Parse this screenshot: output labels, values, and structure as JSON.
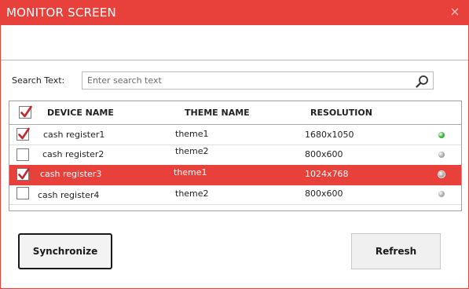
{
  "window": {
    "title": "MONITOR SCREEN",
    "close_glyph": "×"
  },
  "search": {
    "label": "Search Text:",
    "placeholder": "Enter search text",
    "value": ""
  },
  "table": {
    "headers": {
      "device": "DEVICE NAME",
      "theme": "THEME NAME",
      "resolution": "RESOLUTION"
    },
    "select_all_checked": true,
    "rows": [
      {
        "device": "cash register1",
        "theme": "theme1",
        "resolution": "1680x1050",
        "checked": true,
        "selected": false,
        "status": "online"
      },
      {
        "device": "cash register2",
        "theme": "theme2",
        "resolution": "800x600",
        "checked": false,
        "selected": false,
        "status": "offline"
      },
      {
        "device": "cash register3",
        "theme": "theme1",
        "resolution": "1024x768",
        "checked": true,
        "selected": true,
        "status": "offline"
      },
      {
        "device": "cash register4",
        "theme": "theme2",
        "resolution": "800x600",
        "checked": false,
        "selected": false,
        "status": "offline"
      }
    ]
  },
  "buttons": {
    "synchronize": "Synchronize",
    "refresh": "Refresh"
  },
  "colors": {
    "accent": "#e8403a",
    "status_online": "#2db52d",
    "status_offline": "#a8a8a8",
    "check_mark": "#c0282b"
  }
}
